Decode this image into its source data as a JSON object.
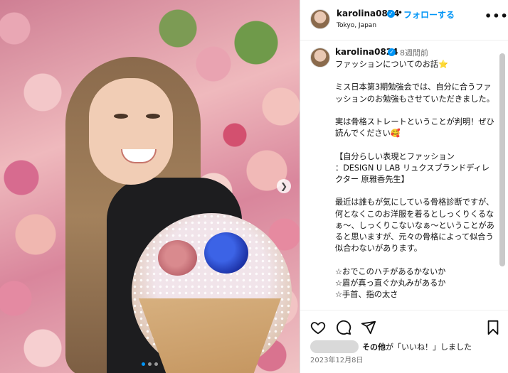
{
  "post": {
    "username": "karolina0824",
    "follow_label": "フォローする",
    "separator": "•",
    "location": "Tokyo, Japan",
    "more_icon": "more-horizontal-icon",
    "time_ago": "8週間前",
    "caption": "ファッションについてのお話⭐\n\nミス日本第3期勉強会では、自分に合うファッションのお勉強もさせていただきました。\n\n実は骨格ストレートということが判明！ぜひ読んでください🥰\n\n【自分らしい表現とファッション\n：DESIGN U LAB リュクスブランドディレクター 原雅香先生】\n\n最近は誰もが気にしている骨格診断ですが、何となくこのお洋服を着るとしっくりくるなぁ〜、しっくりこないなぁ〜ということがあると思いますが、元々の骨格によって似合う似合わないがあります。\n\n☆おでこのハチがあるかないか\n☆眉が真っ直ぐか丸みがあるか\n☆手首、指の太さ",
    "likes_prefix": "その他",
    "likes_suffix": "が「いいね！」しました",
    "date": "2023年12月8日"
  },
  "media": {
    "next_icon": "chevron-right-icon",
    "carousel_count": 3,
    "carousel_active": 0
  },
  "colors": {
    "accent": "#0095f6",
    "muted": "#737373",
    "text": "#111111",
    "border": "#dbdbdb"
  }
}
